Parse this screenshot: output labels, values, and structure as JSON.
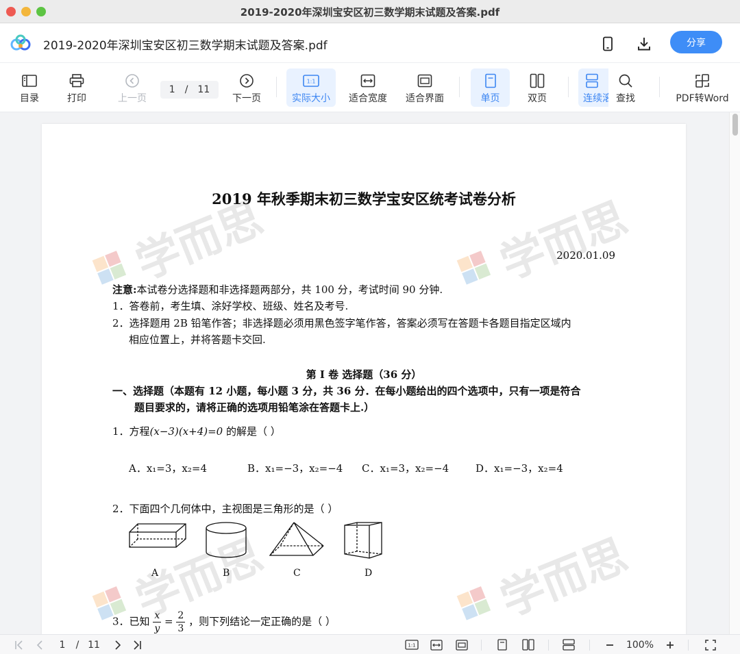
{
  "window": {
    "title": "2019-2020年深圳宝安区初三数学期末试题及答案.pdf"
  },
  "header": {
    "doc_title": "2019-2020年深圳宝安区初三数学期末试题及答案.pdf",
    "share_label": "分享"
  },
  "toolbar": {
    "toc": "目录",
    "print": "打印",
    "prev": "上一页",
    "page_current": "1",
    "page_sep": "/",
    "page_total": "11",
    "next": "下一页",
    "actual_size": "实际大小",
    "fit_width": "适合宽度",
    "fit_page": "适合界面",
    "single": "单页",
    "double": "双页",
    "continuous": "连续滚",
    "search": "查找",
    "pdf_to_word": "PDF转Word",
    "fit_icon_text": "1:1"
  },
  "document": {
    "watermark": "学而思",
    "title": "2019 年秋季期末初三数学宝安区统考试卷分析",
    "date": "2020.01.09",
    "note_label": "注意:",
    "note_text": "本试卷分选择题和非选择题两部分，共 100 分，考试时间 90 分钟.",
    "rule1": "1．答卷前，考生填、涂好学校、班级、姓名及考号.",
    "rule2_a": "2．选择题用 2B 铅笔作答；非选择题必须用黑色签字笔作答，答案必须写在答题卡各题目指定区域内",
    "rule2_b": "相应位置上，并将答题卡交回.",
    "section_title": "第 I 卷   选择题（36 分）",
    "part1_a": "一、选择题（本题有 12 小题，每小题 3 分，共 36 分．在每小题给出的四个选项中，只有一项是符合",
    "part1_b": "题目要求的，请将正确的选项用铅笔涂在答题卡上.）",
    "q1_prefix": "1．方程",
    "q1_expr": "(x−3)(x+4)=0",
    "q1_suffix": " 的解是（      ）",
    "q1_a": "A．x₁=3，x₂=4",
    "q1_b": "B．x₁=−3，x₂=−4",
    "q1_c": "C．x₁=3，x₂=−4",
    "q1_d": "D．x₁=−3，x₂=4",
    "q2": "2．下面四个几何体中，主视图是三角形的是（      ）",
    "q2_labels": [
      "A",
      "B",
      "C",
      "D"
    ],
    "q3_prefix": "3．已知",
    "q3_num_x": "x",
    "q3_den_y": "y",
    "q3_eq": "=",
    "q3_num_2": "2",
    "q3_den_3": "3",
    "q3_suffix": "，则下列结论一定正确的是（      ）"
  },
  "statusbar": {
    "page_current": "1",
    "page_sep": "/",
    "page_total": "11",
    "zoom": "100%",
    "fit_icon_text": "1:1"
  },
  "colors": {
    "accent": "#3e8df7",
    "active_bg": "#e9f2ff"
  }
}
